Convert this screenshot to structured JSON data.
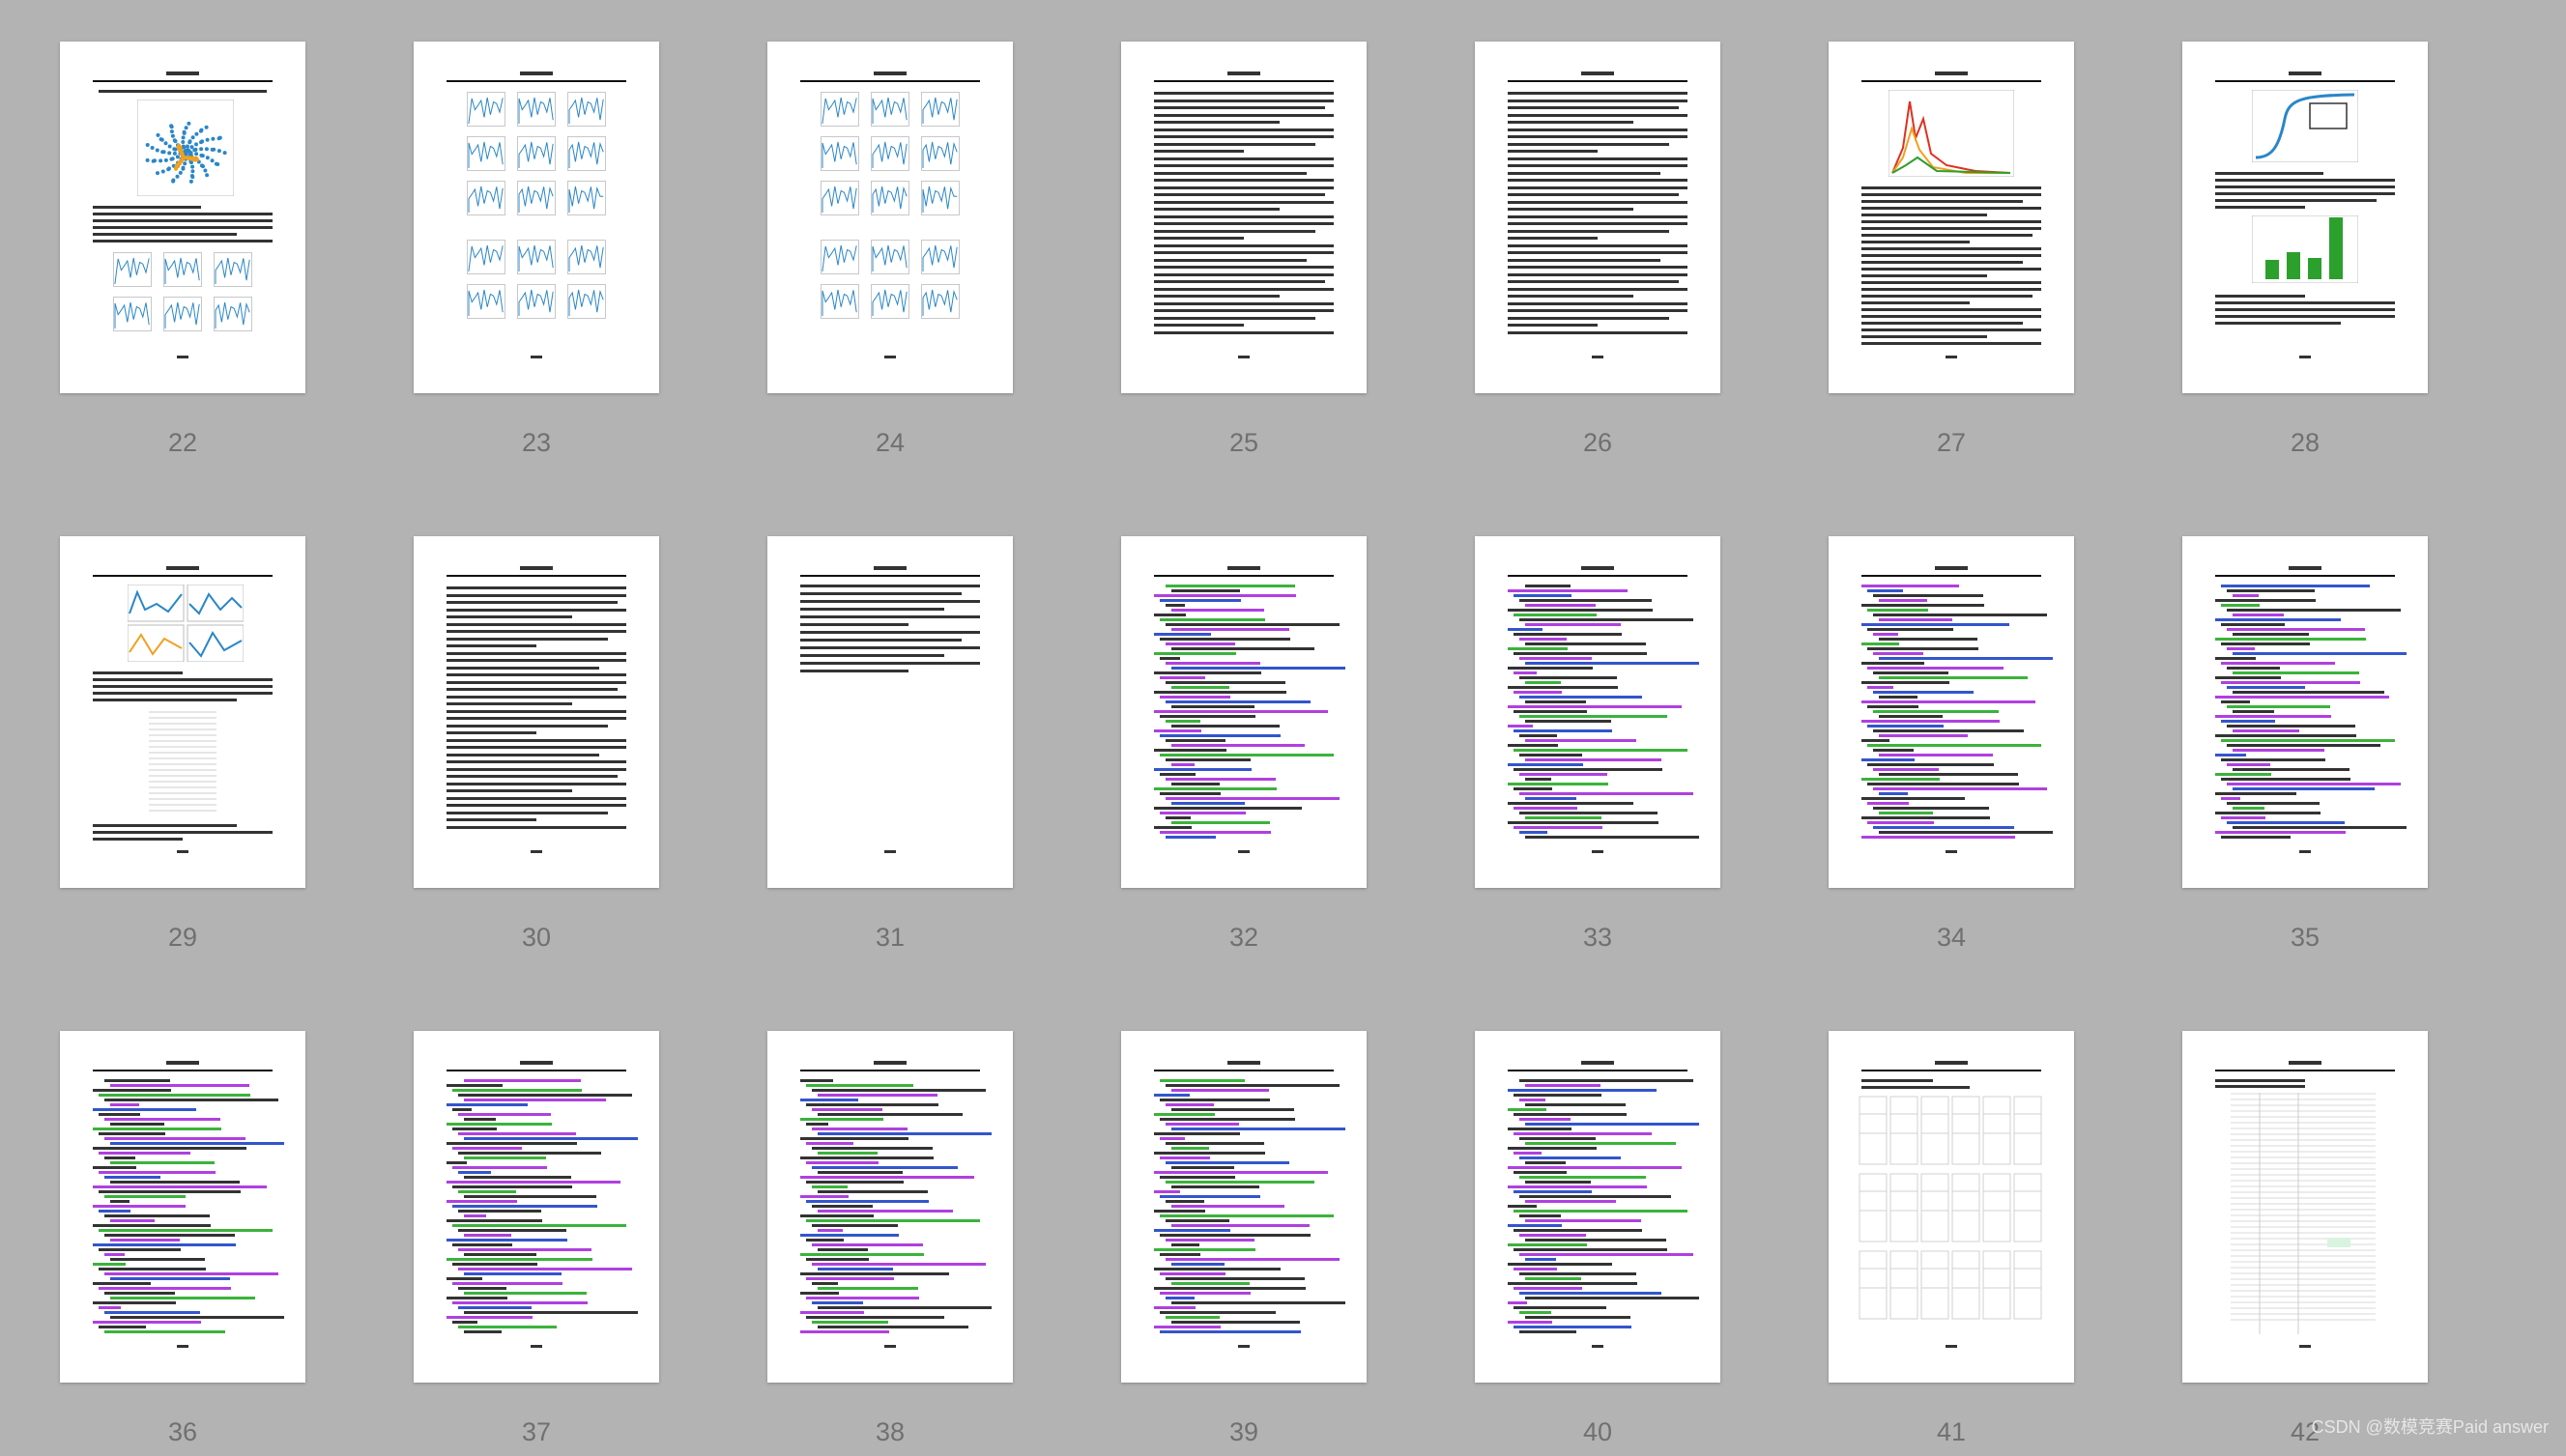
{
  "viewer": {
    "pages": [
      {
        "number": "22",
        "kind": "scatter-chart"
      },
      {
        "number": "23",
        "kind": "small-charts"
      },
      {
        "number": "24",
        "kind": "small-charts"
      },
      {
        "number": "25",
        "kind": "text"
      },
      {
        "number": "26",
        "kind": "text"
      },
      {
        "number": "27",
        "kind": "line-chart"
      },
      {
        "number": "28",
        "kind": "curve-bar"
      },
      {
        "number": "29",
        "kind": "charts-table"
      },
      {
        "number": "30",
        "kind": "text"
      },
      {
        "number": "31",
        "kind": "sparse-text"
      },
      {
        "number": "32",
        "kind": "code"
      },
      {
        "number": "33",
        "kind": "code"
      },
      {
        "number": "34",
        "kind": "code"
      },
      {
        "number": "35",
        "kind": "code"
      },
      {
        "number": "36",
        "kind": "code"
      },
      {
        "number": "37",
        "kind": "code"
      },
      {
        "number": "38",
        "kind": "code"
      },
      {
        "number": "39",
        "kind": "code"
      },
      {
        "number": "40",
        "kind": "code"
      },
      {
        "number": "41",
        "kind": "grid-tables"
      },
      {
        "number": "42",
        "kind": "data-table"
      }
    ],
    "watermark": "CSDN @数模竞赛Paid answer"
  },
  "colors": {
    "background": "#b3b3b3",
    "page": "#ffffff",
    "page_number": "#707070",
    "code_purple": "#b040e0",
    "code_green": "#3bb33b",
    "code_blue": "#3355cc",
    "chart_blue": "#2a86c8",
    "chart_orange": "#f0a020",
    "chart_green": "#2ca02c"
  }
}
